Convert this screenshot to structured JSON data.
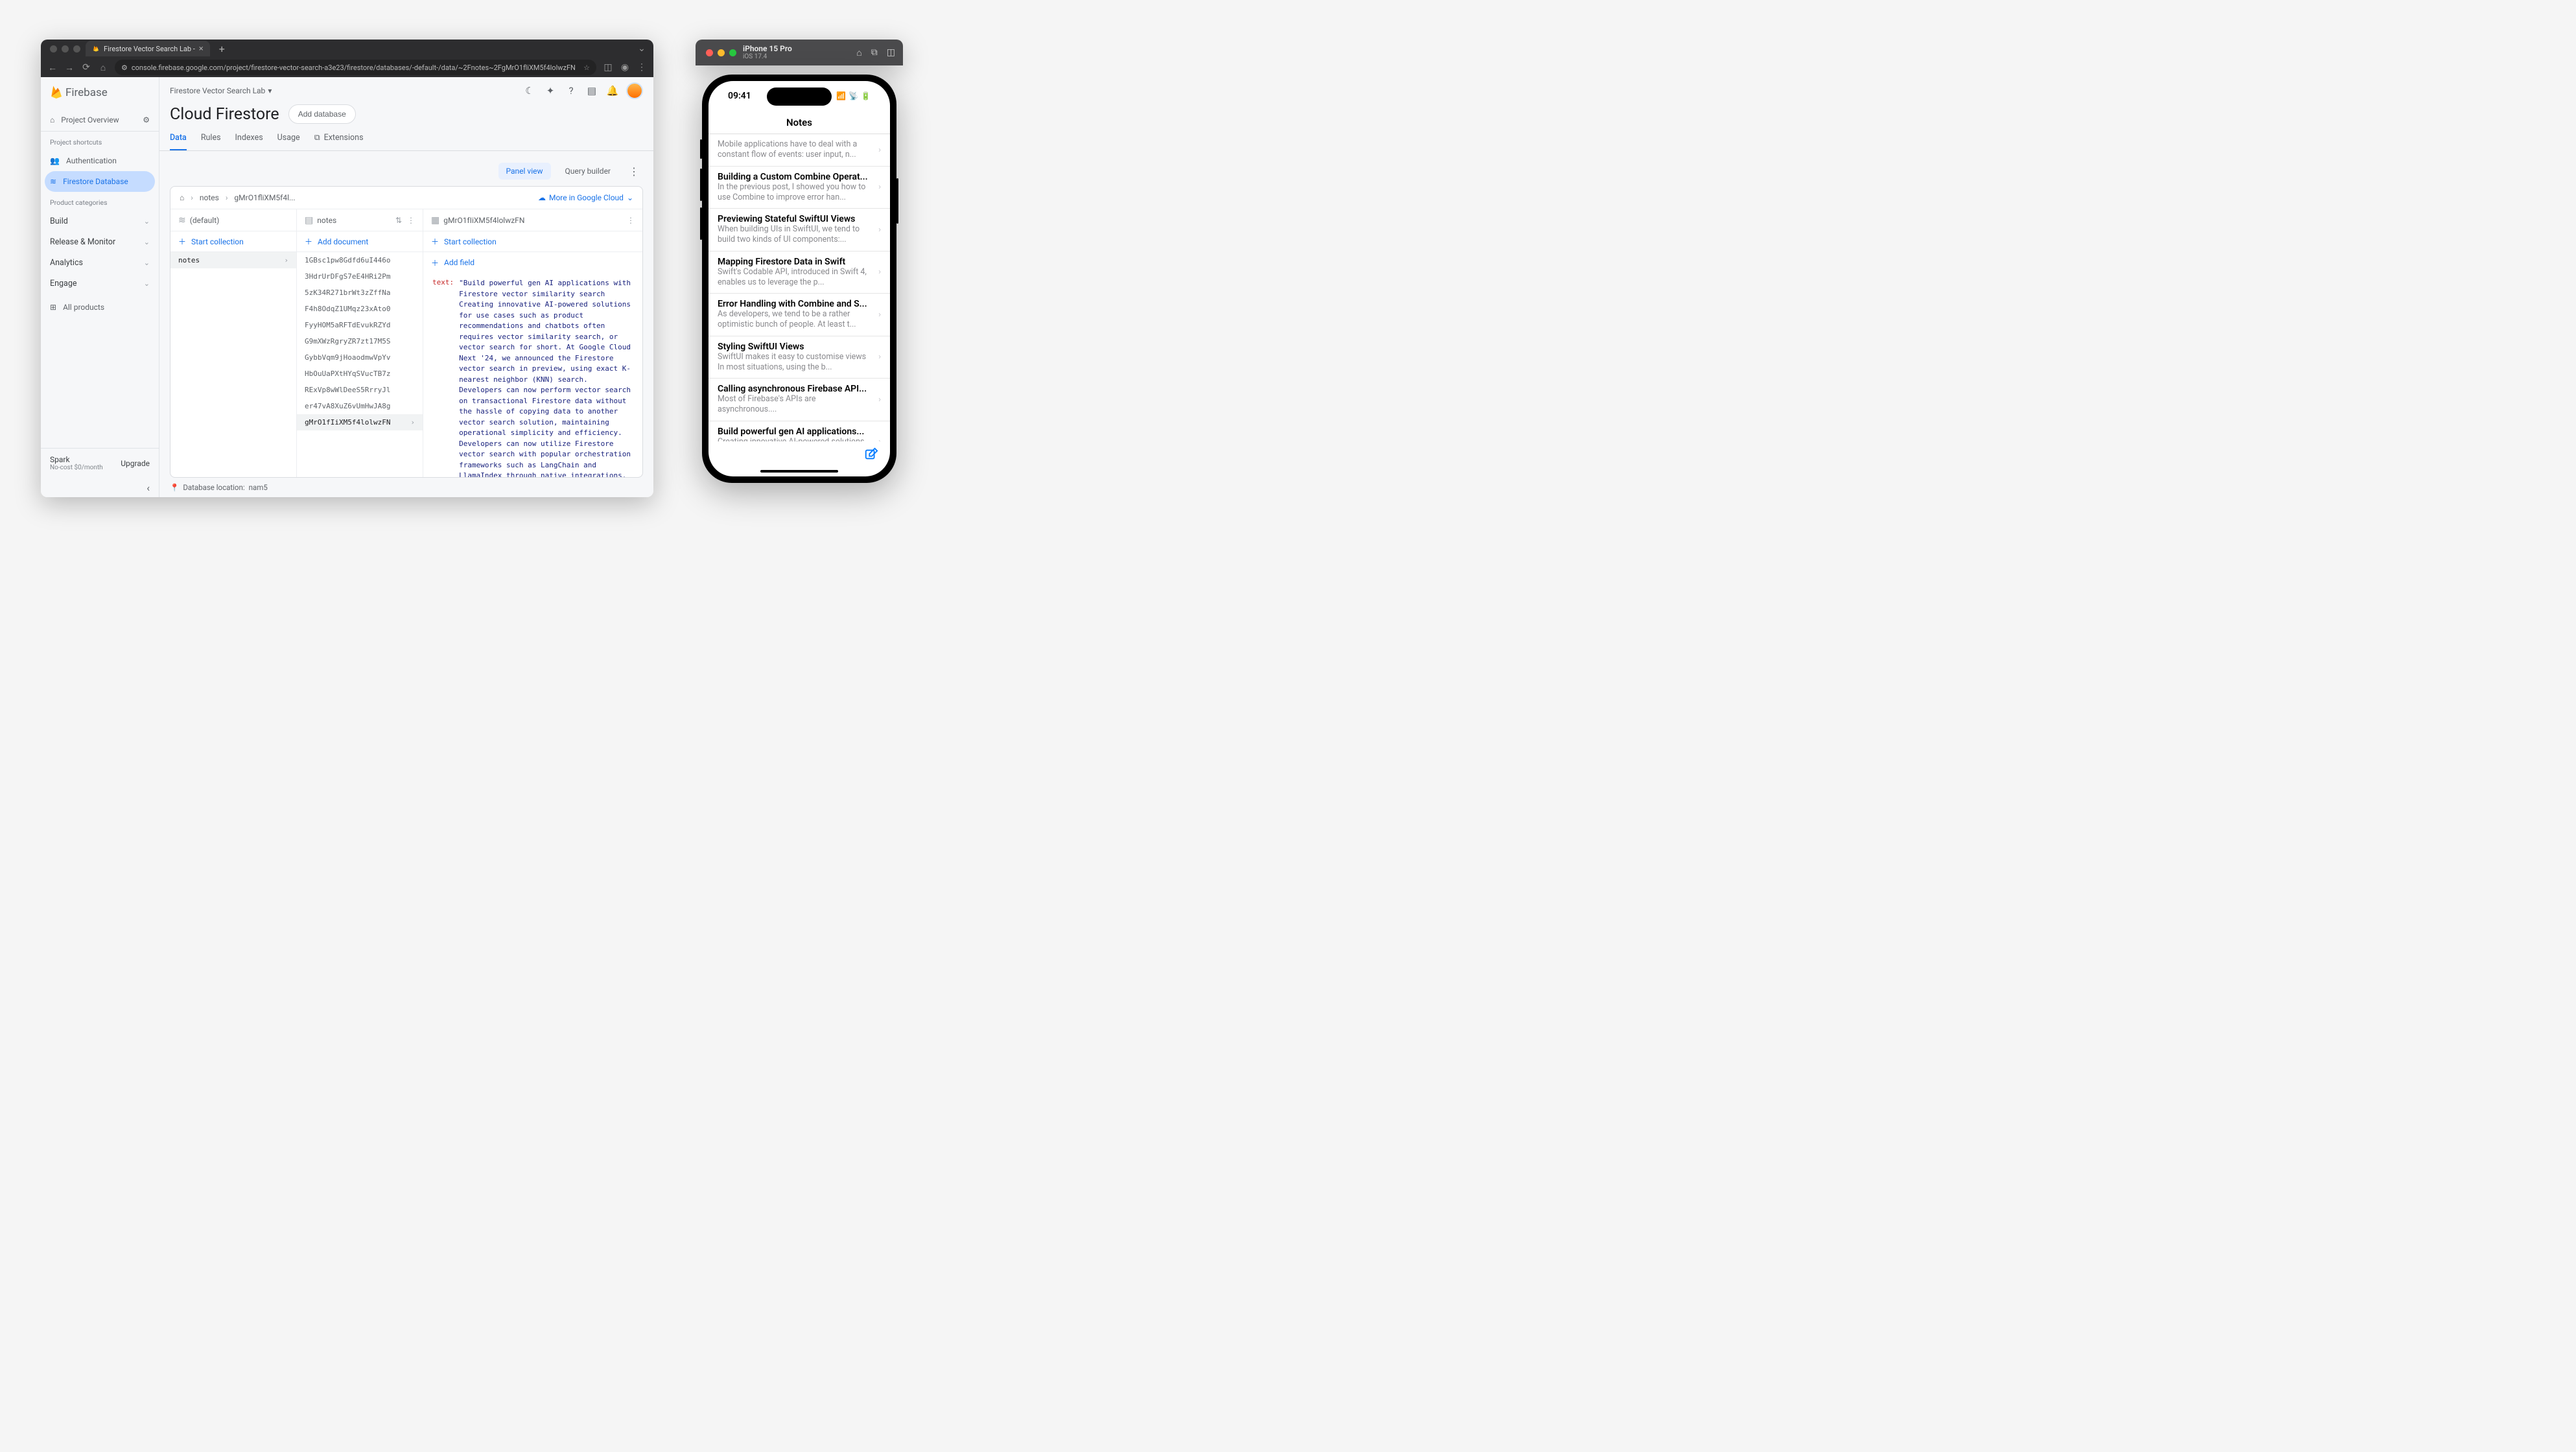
{
  "browser": {
    "tab_title": "Firestore Vector Search Lab - ",
    "url": "console.firebase.google.com/project/firestore-vector-search-a3e23/firestore/databases/-default-/data/~2Fnotes~2FgMrO1fliXM5f4lolwzFN"
  },
  "firebase": {
    "brand": "Firebase",
    "overview": "Project Overview",
    "shortcuts_label": "Project shortcuts",
    "shortcuts": [
      "Authentication",
      "Firestore Database"
    ],
    "categories_label": "Product categories",
    "categories": [
      "Build",
      "Release & Monitor",
      "Analytics",
      "Engage"
    ],
    "all_products": "All products",
    "plan_name": "Spark",
    "plan_sub": "No-cost $0/month",
    "upgrade": "Upgrade",
    "project_name": "Firestore Vector Search Lab",
    "page_title": "Cloud Firestore",
    "add_database": "Add database",
    "tabs": [
      "Data",
      "Rules",
      "Indexes",
      "Usage"
    ],
    "extensions": "Extensions",
    "panel_view": "Panel view",
    "query_builder": "Query builder",
    "breadcrumb": {
      "c1": "notes",
      "c2": "gMrO1fliXM5f4l..."
    },
    "more_in_cloud": "More in Google Cloud",
    "col1_head": "(default)",
    "start_collection": "Start collection",
    "collection_name": "notes",
    "col2_head": "notes",
    "add_document": "Add document",
    "documents": [
      "1GBsc1pw8Gdfd6uI446o",
      "3HdrUrDFgS7eE4HRi2Pm",
      "5zK34R271brWt3zZffNa",
      "F4h8OdqZ1UMqz23xAto0",
      "FyyHOM5aRFTdEvukRZYd",
      "G9mXWzRgryZR7zt17M5S",
      "GybbVqm9jHoaodmwVpYv",
      "HbOuUaPXtHYqSVucTB7z",
      "RExVp8wWlDeeS5RrryJl",
      "er47vA8XuZ6vUmHwJA8g",
      "gMrO1fIiXM5f4lolwzFN"
    ],
    "selected_doc": "gMrO1fIiXM5f4lolwzFN",
    "col3_head": "gMrO1fIiXM5f4lolwzFN",
    "add_field": "Add field",
    "field_key": "text:",
    "field_val": "\"Build powerful gen AI applications with Firestore vector similarity search Creating innovative AI-powered solutions for use cases such as product recommendations and chatbots often requires vector similarity search, or vector search for short. At Google Cloud Next '24, we announced the Firestore vector search in preview, using exact K-nearest neighbor (KNN) search. Developers can now perform vector search on transactional Firestore data without the hassle of copying data to another vector search solution, maintaining operational simplicity and efficiency. Developers can now utilize Firestore vector search with popular orchestration frameworks such as LangChain and LlamaIndex through native integrations. We've also launched a new Firestore extension to make it easier for you to automatically compute vector embeddings on your data, and create web services that make it easier for you to perform vector searches from a web or mobile application. In this blog, we'll discuss how developers can get started with Firestore's new vector search",
    "db_location_label": "Database location:",
    "db_location": "nam5"
  },
  "simulator": {
    "device": "iPhone 15 Pro",
    "os": "iOS 17.4",
    "time": "09:41",
    "nav_title": "Notes",
    "notes": [
      {
        "title": "",
        "body": "Mobile applications have to deal with a constant flow of events: user input, n...",
        "partial": true
      },
      {
        "title": "Building a Custom Combine Operat...",
        "body": "In the previous post, I showed you how to use Combine to improve error han..."
      },
      {
        "title": "Previewing Stateful SwiftUI Views",
        "body": "When building UIs in SwiftUI, we tend to build two kinds of UI components:..."
      },
      {
        "title": "Mapping Firestore Data in Swift",
        "body": "Swift's Codable API, introduced in Swift 4, enables us to leverage the p..."
      },
      {
        "title": "Error Handling with Combine and S...",
        "body": "As developers, we tend to be a rather optimistic bunch of people. At least t..."
      },
      {
        "title": "Styling SwiftUI Views",
        "body": "SwiftUI makes it easy to customise views In most situations, using the b..."
      },
      {
        "title": "Calling asynchronous Firebase API...",
        "body": "Most of Firebase's APIs are asynchronous...."
      },
      {
        "title": "Build powerful gen AI applications...",
        "body": "Creating innovative AI-powered solutions for use cases such as prod..."
      }
    ]
  }
}
